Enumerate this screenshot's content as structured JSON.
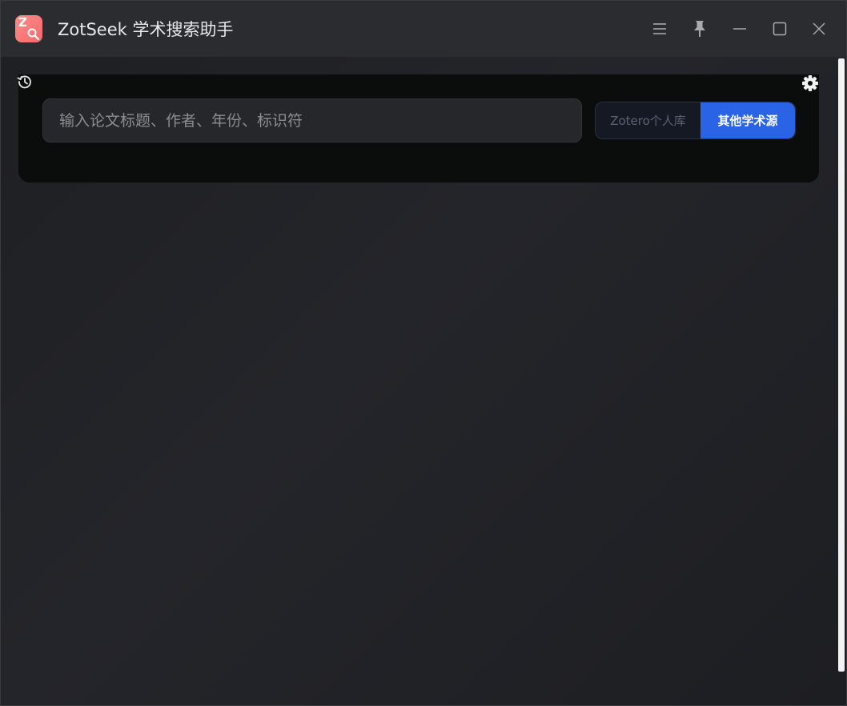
{
  "window": {
    "title": "ZotSeek 学术搜索助手",
    "logo_letter": "Z"
  },
  "titlebar_icons": [
    "menu-icon",
    "pin-icon",
    "minimize-icon",
    "maximize-icon",
    "close-icon"
  ],
  "search": {
    "placeholder": "输入论文标题、作者、年份、标识符",
    "value": ""
  },
  "source_toggle": {
    "options": [
      "Zotero个人库",
      "其他学术源"
    ],
    "selected": "其他学术源"
  },
  "panel_icons": [
    "history-icon",
    "settings-icon"
  ],
  "colors": {
    "accent": "#2a63e6",
    "logo": "#f36a6a",
    "titlebar": "#2b2c30",
    "panel": "#0b0c0c"
  }
}
